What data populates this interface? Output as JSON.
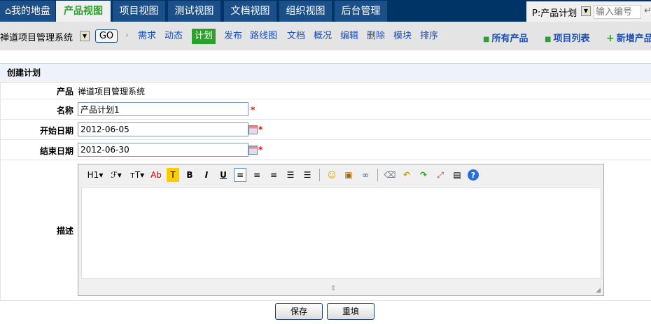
{
  "topnav": {
    "tabs": [
      "我的地盘",
      "产品视图",
      "项目视图",
      "测试视图",
      "文档视图",
      "组织视图",
      "后台管理"
    ],
    "active": 1,
    "quick_select": "P:产品计划",
    "quick_placeholder": "输入编号"
  },
  "subnav": {
    "product": "禅道项目管理系统",
    "go": "GO",
    "links": [
      "需求",
      "动态",
      "计划",
      "发布",
      "路线图",
      "文档",
      "概况",
      "编辑",
      "删除",
      "模块",
      "排序"
    ],
    "active": 2,
    "right": [
      "所有产品",
      "项目列表",
      "新增产品"
    ]
  },
  "form": {
    "title": "创建计划",
    "product_label": "产品",
    "product_value": "禅道项目管理系统",
    "name_label": "名称",
    "name_value": "产品计划1",
    "begin_label": "开始日期",
    "begin_value": "2012-06-05",
    "end_label": "结束日期",
    "end_value": "2012-06-30",
    "desc_label": "描述",
    "required": "*",
    "save": "保存",
    "reset": "重填"
  },
  "editor": {
    "tools": [
      "H1▾",
      "ℱ▾",
      "ᴛT▾",
      "Ab",
      "T",
      "B",
      "I",
      "U",
      "≡",
      "≡",
      "≡",
      "☰",
      "☰",
      "☺",
      "▣",
      "∞",
      "⌫",
      "↶",
      "↷",
      "⤢",
      "▤",
      "?"
    ]
  }
}
